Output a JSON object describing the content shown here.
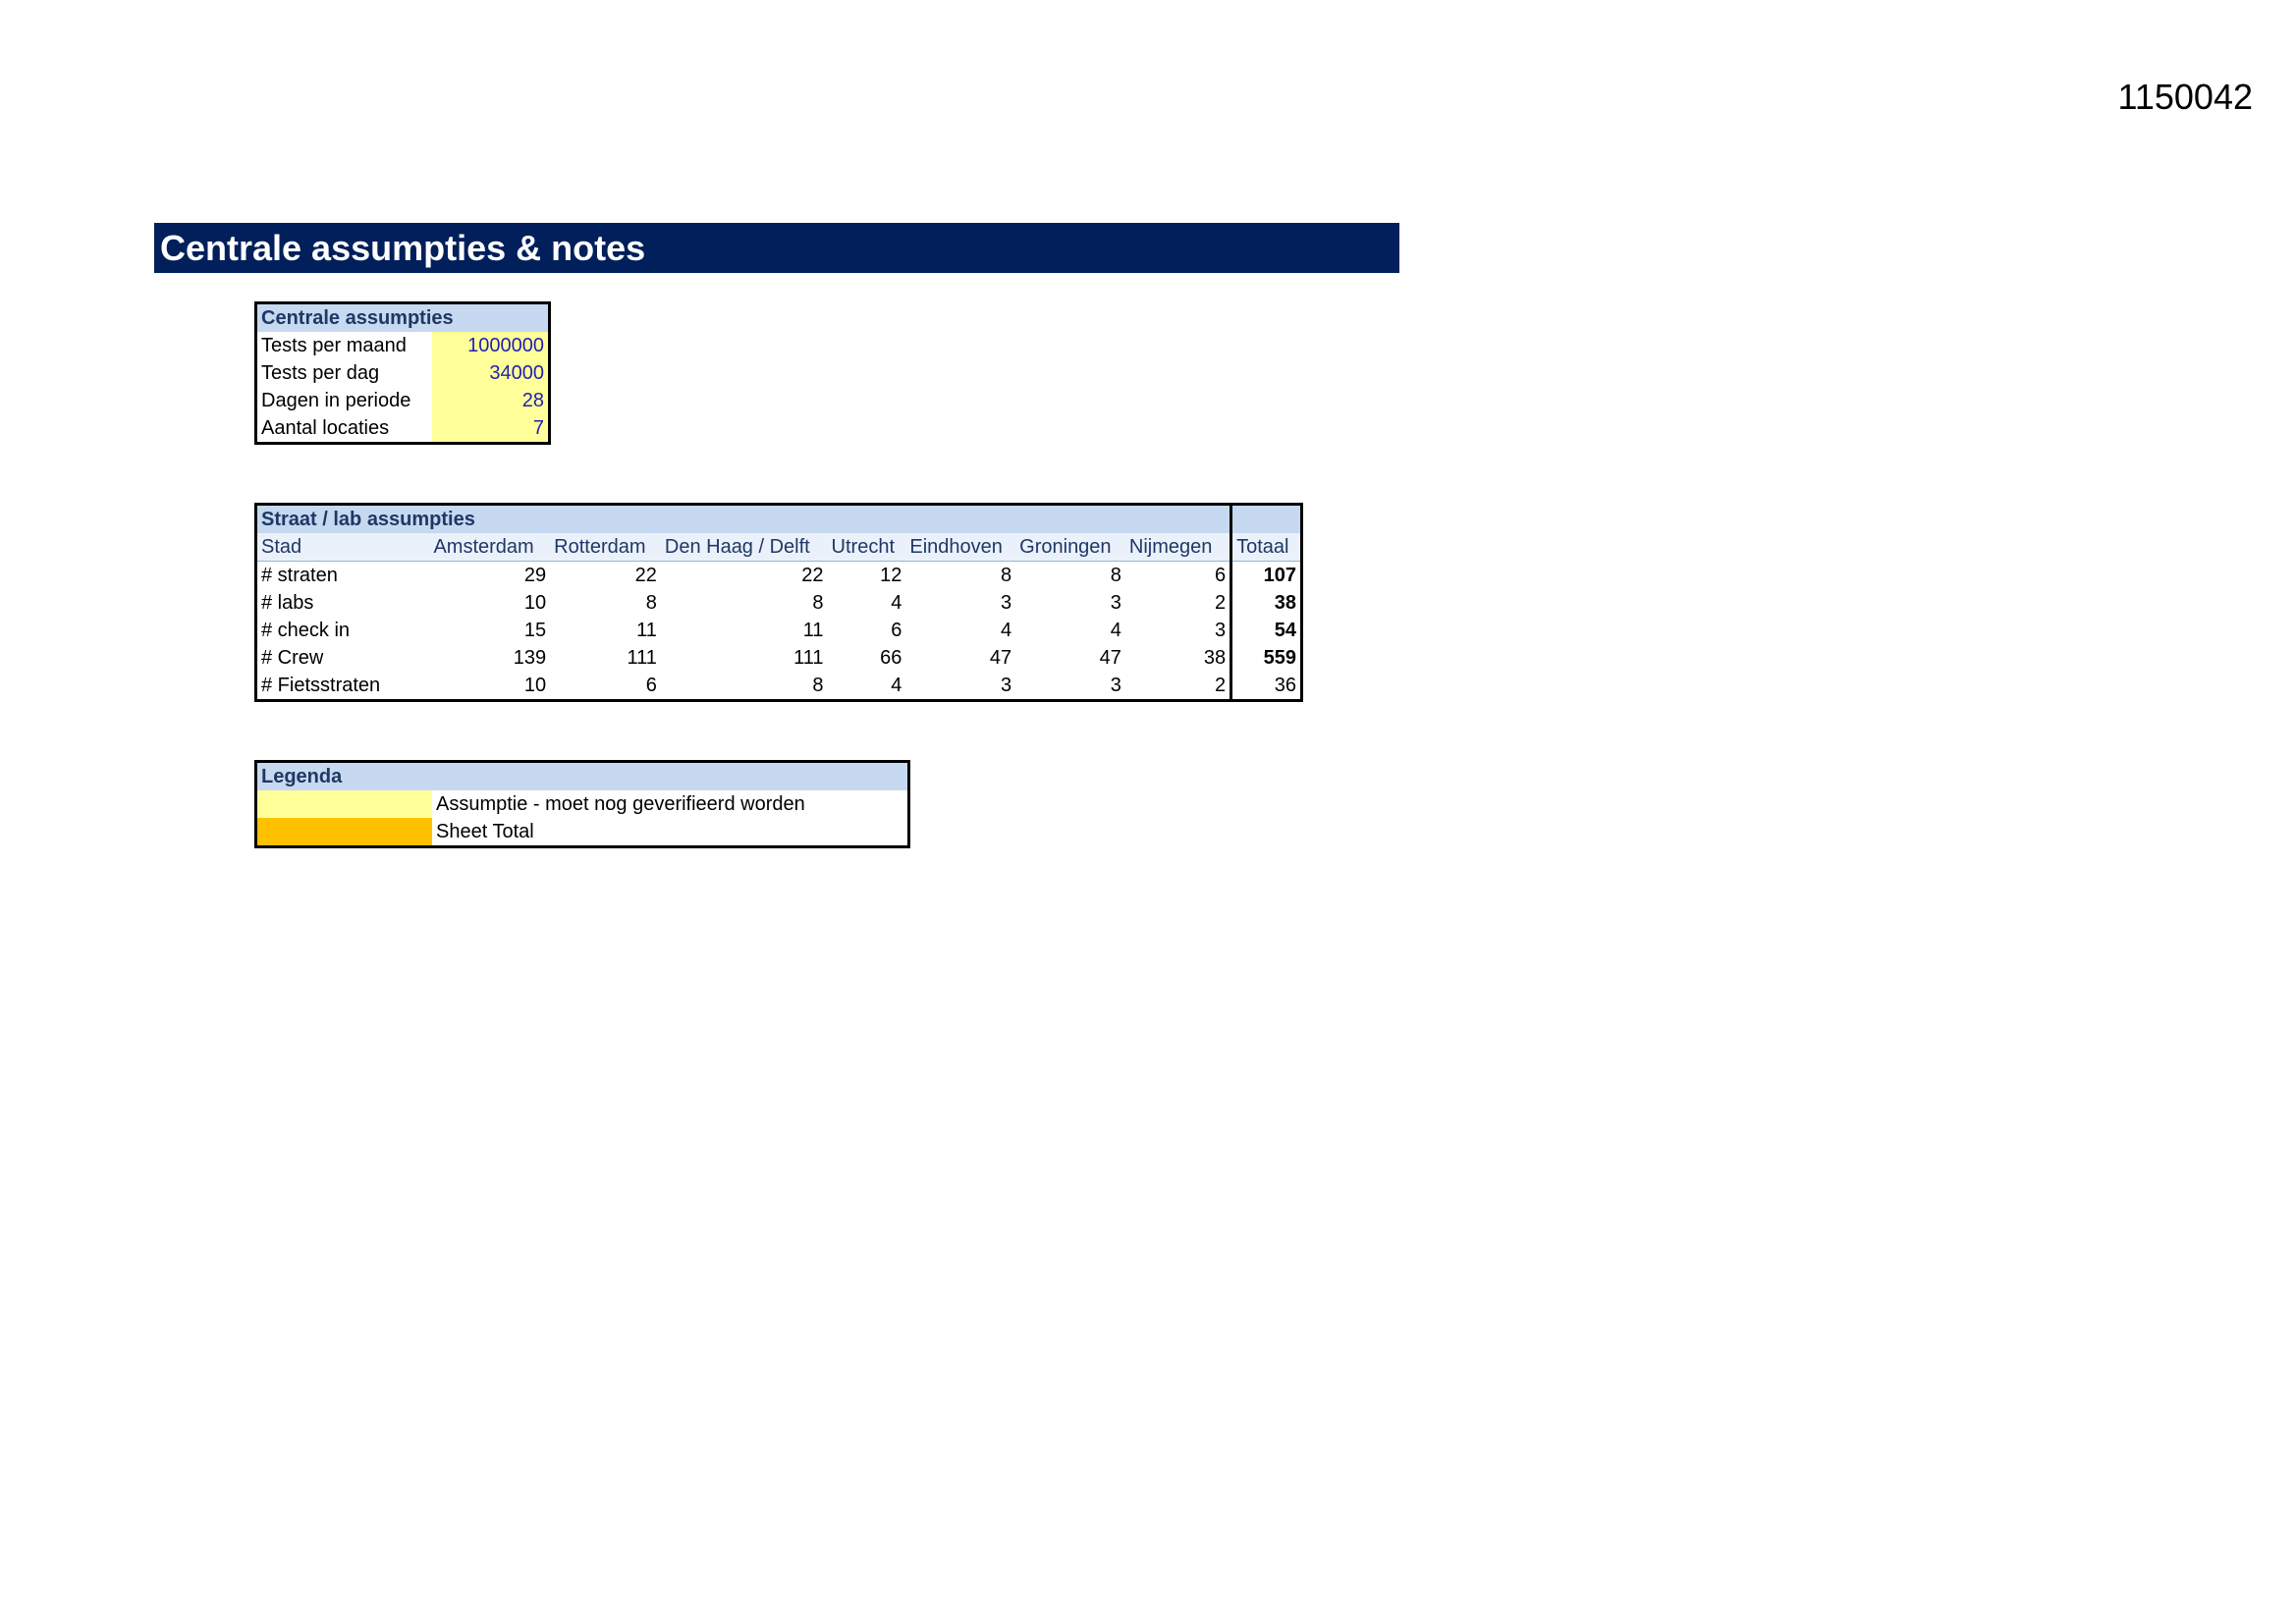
{
  "doc_id": "1150042",
  "title": "Centrale assumpties & notes",
  "central": {
    "header": "Centrale assumpties",
    "rows": [
      {
        "label": "Tests per maand",
        "value": "1000000"
      },
      {
        "label": "Tests per dag",
        "value": "34000"
      },
      {
        "label": "Dagen in periode",
        "value": "28"
      },
      {
        "label": "Aantal locaties",
        "value": "7"
      }
    ]
  },
  "street": {
    "header": "Straat / lab assumpties",
    "columns": [
      "Stad",
      "Amsterdam",
      "Rotterdam",
      "Den Haag / Delft",
      "Utrecht",
      "Eindhoven",
      "Groningen",
      "Nijmegen",
      "Totaal"
    ],
    "rows": [
      {
        "label": "# straten",
        "values": [
          "29",
          "22",
          "22",
          "12",
          "8",
          "8",
          "6"
        ],
        "total": "107"
      },
      {
        "label": "# labs",
        "values": [
          "10",
          "8",
          "8",
          "4",
          "3",
          "3",
          "2"
        ],
        "total": "38"
      },
      {
        "label": "# check in",
        "values": [
          "15",
          "11",
          "11",
          "6",
          "4",
          "4",
          "3"
        ],
        "total": "54"
      },
      {
        "label": "# Crew",
        "values": [
          "139",
          "111",
          "111",
          "66",
          "47",
          "47",
          "38"
        ],
        "total": "559"
      },
      {
        "label": "# Fietsstraten",
        "values": [
          "10",
          "6",
          "8",
          "4",
          "3",
          "3",
          "2"
        ],
        "total": "36"
      }
    ]
  },
  "legend": {
    "header": "Legenda",
    "items": [
      {
        "label": "Assumptie - moet nog geverifieerd worden",
        "color": "#ffff99"
      },
      {
        "label": "Sheet Total",
        "color": "#ffc000"
      }
    ]
  }
}
